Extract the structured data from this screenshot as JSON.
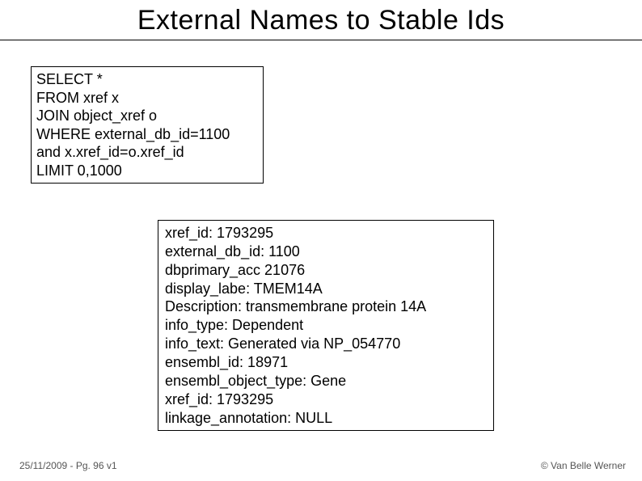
{
  "title": "External Names to Stable Ids",
  "sql": {
    "l1": "SELECT *",
    "l2": "FROM xref x",
    "l3": "JOIN object_xref o",
    "l4": "WHERE external_db_id=1100",
    "l5": "and x.xref_id=o.xref_id",
    "l6": "LIMIT 0,1000"
  },
  "result": {
    "l1": "xref_id: 1793295",
    "l2": "external_db_id: 1100",
    "l3": "dbprimary_acc 21076",
    "l4": "display_labe: TMEM14A",
    "l5": "Description: transmembrane protein 14A",
    "l6": "info_type: Dependent",
    "l7": "info_text: Generated via NP_054770",
    "l8": "ensembl_id: 18971",
    "l9": "ensembl_object_type: Gene",
    "l10": "xref_id: 1793295",
    "l11": "linkage_annotation: NULL"
  },
  "footer": {
    "left": "25/11/2009 - Pg. 96 v1",
    "right": "© Van Belle Werner"
  }
}
